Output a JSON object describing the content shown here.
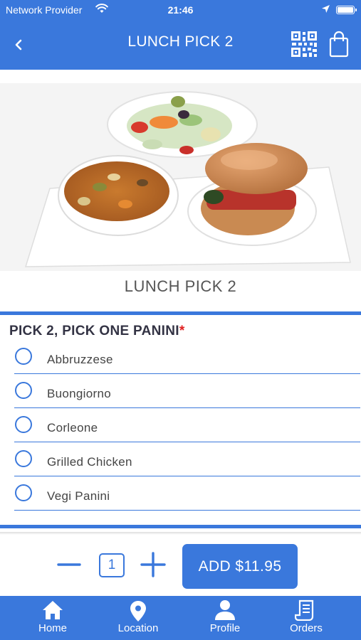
{
  "status_bar": {
    "provider": "Network Provider",
    "time": "21:46",
    "icons": [
      "wifi-icon",
      "location-arrow-icon",
      "battery-icon"
    ]
  },
  "nav": {
    "title": "LUNCH PICK 2",
    "icons": [
      "back-chevron-icon",
      "qr-code-icon",
      "shopping-bag-icon"
    ]
  },
  "product": {
    "name": "LUNCH PICK 2"
  },
  "section": {
    "title": "PICK 2, PICK ONE PANINI",
    "required_mark": "*",
    "options": [
      {
        "label": "Abbruzzese",
        "selected": false
      },
      {
        "label": "Buongiorno",
        "selected": false
      },
      {
        "label": "Corleone",
        "selected": false
      },
      {
        "label": "Grilled Chicken",
        "selected": false
      },
      {
        "label": "Vegi Panini",
        "selected": false
      }
    ]
  },
  "order": {
    "quantity": "1",
    "add_label": "ADD $11.95"
  },
  "tabbar": {
    "items": [
      {
        "label": "Home",
        "icon": "home-icon"
      },
      {
        "label": "Location",
        "icon": "map-pin-icon"
      },
      {
        "label": "Profile",
        "icon": "person-icon"
      },
      {
        "label": "Orders",
        "icon": "receipt-icon"
      }
    ]
  },
  "colors": {
    "primary": "#3a78dc",
    "required": "#e02020",
    "text": "#444444"
  }
}
